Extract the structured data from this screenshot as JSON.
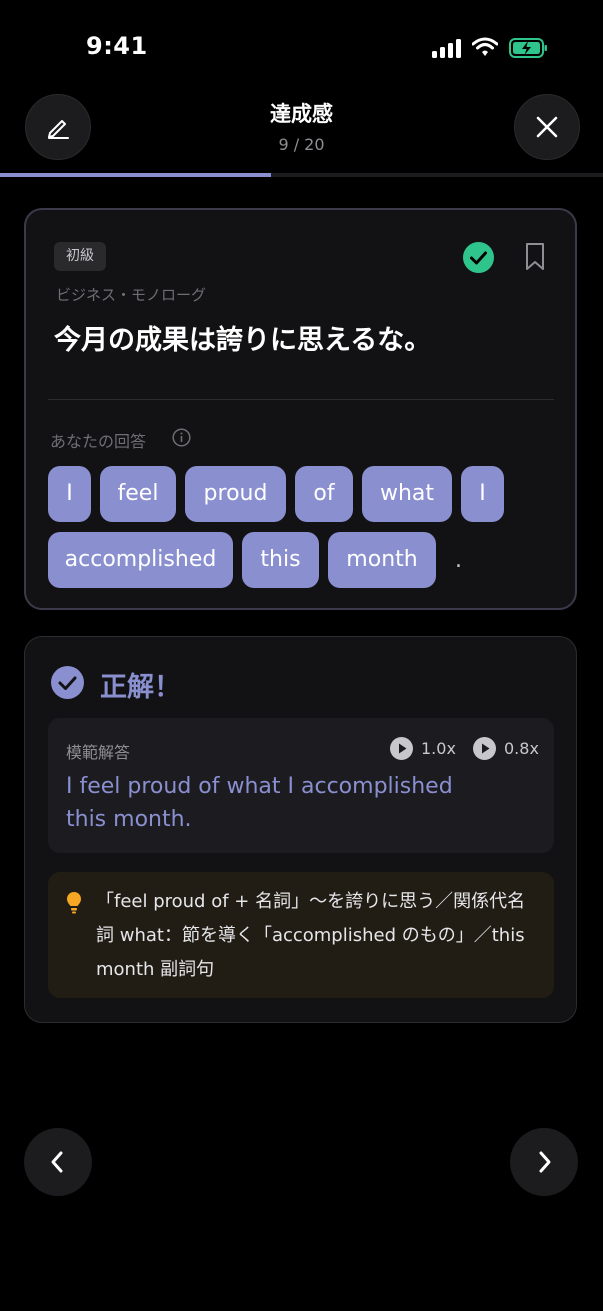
{
  "status_bar": {
    "time": "9:41"
  },
  "header": {
    "title": "達成感",
    "counter": "9 / 20",
    "progress": 0.45
  },
  "question_card": {
    "level_badge": "初級",
    "category": "ビジネス・モノローグ",
    "question": "今月の成果は誇りに思えるな。",
    "answer_label": "あなたの回答",
    "answer_words": [
      "I",
      "feel",
      "proud",
      "of",
      "what",
      "I",
      "accomplished",
      "this",
      "month"
    ],
    "answer_punctuation": "."
  },
  "result_card": {
    "result_label": "正解！",
    "model_label": "模範解答",
    "speed_normal": "1.0x",
    "speed_slow": "0.8x",
    "model_answer": "I feel proud of what I accomplished this month.",
    "tip": "「feel proud of + 名詞」〜を誇りに思う／関係代名詞 what：節を導く「accomplished のもの」／this month 副詞句"
  },
  "colors": {
    "accent": "#8a8fd0",
    "success": "#30c48d",
    "background": "#000000",
    "tip_bulb": "#f5a623"
  },
  "icons": [
    "edit-icon",
    "close-icon",
    "check-circle-icon",
    "bookmark-icon",
    "info-icon",
    "play-icon",
    "lightbulb-icon",
    "chevron-left-icon",
    "chevron-right-icon"
  ]
}
